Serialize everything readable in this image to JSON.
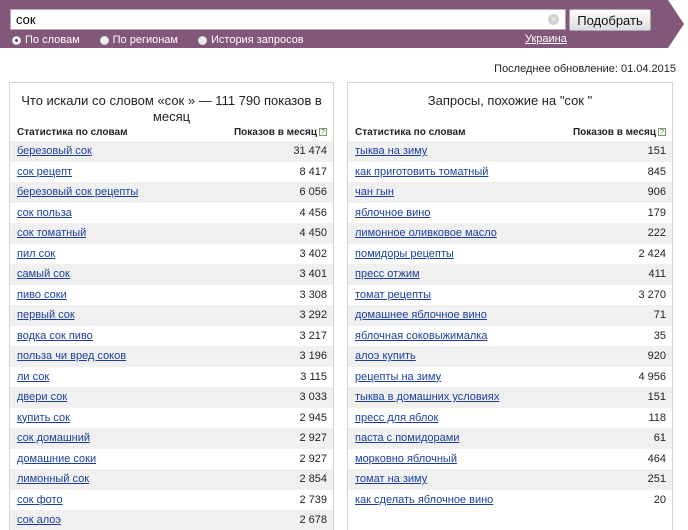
{
  "search": {
    "query": "сок",
    "submit_label": "Подобрать",
    "clear_symbol": "×",
    "radio_options": [
      {
        "label": "По словам",
        "selected": true
      },
      {
        "label": "По регионам",
        "selected": false
      },
      {
        "label": "История запросов",
        "selected": false
      }
    ],
    "region_label": "Украина"
  },
  "last_update": "Последнее обновление: 01.04.2015",
  "colors": {
    "header_bg": "#82577a",
    "link": "#1a3fa0",
    "row_alt": "#f0f0f0"
  },
  "left_panel": {
    "title": "Что искали со словом «сок » — 111 790 показов в месяц",
    "col_word": "Статистика по словам",
    "col_count": "Показов в месяц",
    "help": "?",
    "rows": [
      {
        "phrase": "березовый сок",
        "count": "31 474"
      },
      {
        "phrase": "сок рецепт",
        "count": "8 417"
      },
      {
        "phrase": "березовый сок рецепты",
        "count": "6 056"
      },
      {
        "phrase": "сок польза",
        "count": "4 456"
      },
      {
        "phrase": "сок томатный",
        "count": "4 450"
      },
      {
        "phrase": "пил сок",
        "count": "3 402"
      },
      {
        "phrase": "самый сок",
        "count": "3 401"
      },
      {
        "phrase": "пиво соки",
        "count": "3 308"
      },
      {
        "phrase": "первый сок",
        "count": "3 292"
      },
      {
        "phrase": "водка сок пиво",
        "count": "3 217"
      },
      {
        "phrase": "польза чи вред соков",
        "count": "3 196"
      },
      {
        "phrase": "ли сок",
        "count": "3 115"
      },
      {
        "phrase": "двери сок",
        "count": "3 033"
      },
      {
        "phrase": "купить сок",
        "count": "2 945"
      },
      {
        "phrase": "сок домашний",
        "count": "2 927"
      },
      {
        "phrase": "домашние соки",
        "count": "2 927"
      },
      {
        "phrase": "лимонный сок",
        "count": "2 854"
      },
      {
        "phrase": "сок фото",
        "count": "2 739"
      },
      {
        "phrase": "сок алоэ",
        "count": "2 678"
      }
    ]
  },
  "right_panel": {
    "title": "Запросы, похожие на \"сок \"",
    "col_word": "Статистика по словам",
    "col_count": "Показов в месяц",
    "help": "?",
    "rows": [
      {
        "phrase": "тыква на зиму",
        "count": "151"
      },
      {
        "phrase": "как приготовить томатный",
        "count": "845"
      },
      {
        "phrase": "чан гын",
        "count": "906"
      },
      {
        "phrase": "яблочное вино",
        "count": "179"
      },
      {
        "phrase": "лимонное оливковое масло",
        "count": "222"
      },
      {
        "phrase": "помидоры рецепты",
        "count": "2 424"
      },
      {
        "phrase": "пресс отжим",
        "count": "411"
      },
      {
        "phrase": "томат рецепты",
        "count": "3 270"
      },
      {
        "phrase": "домашнее яблочное вино",
        "count": "71"
      },
      {
        "phrase": "яблочная соковыжималка",
        "count": "35"
      },
      {
        "phrase": "алоэ купить",
        "count": "920"
      },
      {
        "phrase": "рецепты на зиму",
        "count": "4 956"
      },
      {
        "phrase": "тыква в домашних условиях",
        "count": "151"
      },
      {
        "phrase": "пресс для яблок",
        "count": "118"
      },
      {
        "phrase": "паста с помидорами",
        "count": "61"
      },
      {
        "phrase": "морковно яблочный",
        "count": "464"
      },
      {
        "phrase": "томат на зиму",
        "count": "251"
      },
      {
        "phrase": "как сделать яблочное вино",
        "count": "20"
      }
    ]
  }
}
